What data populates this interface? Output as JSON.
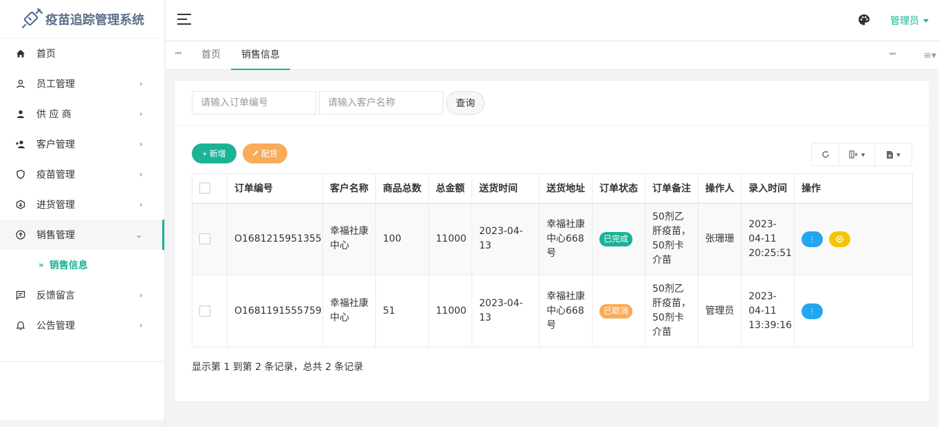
{
  "app": {
    "title": "疫苗追踪管理系统"
  },
  "sidebar": {
    "items": [
      {
        "label": "首页",
        "icon": "home-icon",
        "has_arrow": false
      },
      {
        "label": "员工管理",
        "icon": "user-outline-icon",
        "has_arrow": true
      },
      {
        "label": "供 应 商",
        "icon": "user-solid-icon",
        "has_arrow": true
      },
      {
        "label": "客户管理",
        "icon": "user-plus-icon",
        "has_arrow": true
      },
      {
        "label": "疫苗管理",
        "icon": "shield-icon",
        "has_arrow": true
      },
      {
        "label": "进货管理",
        "icon": "hexagon-download-icon",
        "has_arrow": true
      },
      {
        "label": "销售管理",
        "icon": "circle-upload-icon",
        "has_arrow": true,
        "expanded": true
      }
    ],
    "sub_item": {
      "label": "销售信息"
    },
    "items_after": [
      {
        "label": "反馈留言",
        "icon": "message-icon"
      },
      {
        "label": "公告管理",
        "icon": "bell-icon"
      }
    ]
  },
  "header": {
    "user_label": "管理员"
  },
  "tabs": {
    "items": [
      {
        "label": "首页",
        "active": false
      },
      {
        "label": "销售信息",
        "active": true
      }
    ],
    "prev_label": "⏮",
    "next_label": "⏭",
    "menu_label": "≡▾"
  },
  "search": {
    "order_placeholder": "请输入订单编号",
    "customer_placeholder": "请输入客户名称",
    "query_label": "查询"
  },
  "actions": {
    "add_label": "+ 新增",
    "distribute_label": "配货"
  },
  "table": {
    "headers": [
      "订单编号",
      "客户名称",
      "商品总数",
      "总金额",
      "送货时间",
      "送货地址",
      "订单状态",
      "订单备注",
      "操作人",
      "录入时间",
      "操作"
    ],
    "rows": [
      {
        "order_no": "O1681215951355",
        "customer": "幸福社康中心",
        "quantity": "100",
        "amount": "11000",
        "delivery_time": "2023-04-13",
        "address": "幸福社康中心668号",
        "status": "已完成",
        "status_type": "done",
        "remark": "50剂乙肝疫苗，50剂卡介苗",
        "operator": "张珊珊",
        "entry_time": "2023-04-11 20:25:51",
        "has_cancel": true
      },
      {
        "order_no": "O1681191555759",
        "customer": "幸福社康中心",
        "quantity": "51",
        "amount": "11000",
        "delivery_time": "2023-04-13",
        "address": "幸福社康中心668号",
        "status": "已取消",
        "status_type": "cancel",
        "remark": "50剂乙肝疫苗，50剂卡介苗",
        "operator": "管理员",
        "entry_time": "2023-04-11 13:39:16",
        "has_cancel": false
      }
    ]
  },
  "pagination": {
    "summary": "显示第 1 到第 2 条记录，总共 2 条记录"
  },
  "colors": {
    "accent": "#1ab394",
    "warning": "#f8ac59",
    "info": "#23a6f0",
    "yellow": "#f7c400"
  }
}
